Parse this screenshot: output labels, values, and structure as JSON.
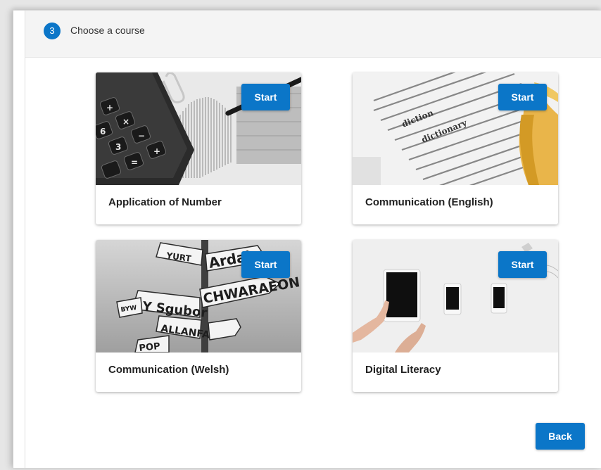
{
  "step": {
    "number": "3",
    "title": "Choose a course"
  },
  "courses": [
    {
      "title": "Application of Number",
      "start_label": "Start",
      "image": "calculator-and-graph-photo"
    },
    {
      "title": "Communication (English)",
      "start_label": "Start",
      "image": "dictionary-and-tassel-photo"
    },
    {
      "title": "Communication (Welsh)",
      "start_label": "Start",
      "image": "welsh-signpost-photo"
    },
    {
      "title": "Digital Literacy",
      "start_label": "Start",
      "image": "tablet-and-phones-photo"
    }
  ],
  "sign_words": [
    "Ardal",
    "CHWARAEON",
    "Y Sgubor",
    "ALLANFA",
    "BYW",
    "YURT",
    "POP"
  ],
  "back_label": "Back",
  "colors": {
    "primary": "#0b76c8",
    "header_bg": "#f4f4f4",
    "title_text": "#222222"
  }
}
